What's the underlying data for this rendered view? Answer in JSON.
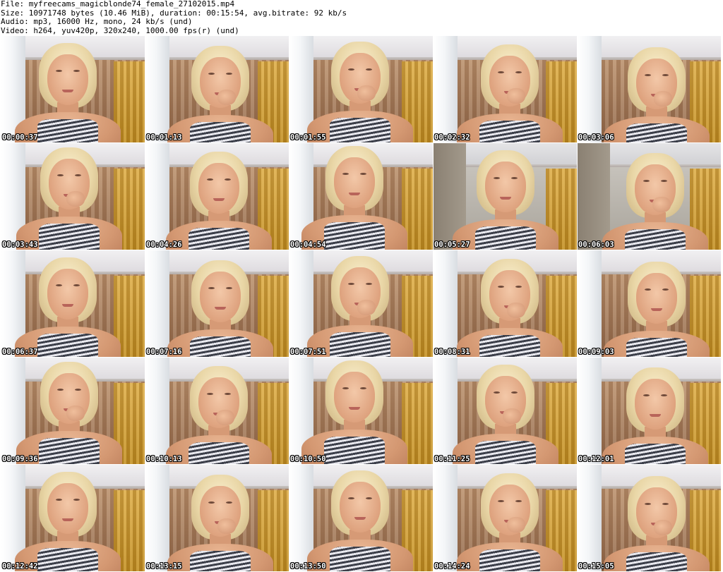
{
  "header": {
    "file_line": "File: myfreecams_magicblonde74_female_27102015.mp4",
    "size_line": "Size: 10971748 bytes (10.46 MiB), duration: 00:15:54, avg.bitrate: 92 kb/s",
    "audio_line": "Audio: mp3, 16000 Hz, mono, 24 kb/s (und)",
    "video_line": "Video: h264, yuv420p, 320x240, 1000.00 fps(r) (und)"
  },
  "thumbnails": [
    {
      "time": "00:00:37",
      "variant": "std",
      "hand": false
    },
    {
      "time": "00:01:13",
      "variant": "std",
      "hand": true
    },
    {
      "time": "00:01:55",
      "variant": "std",
      "hand": true
    },
    {
      "time": "00:02:32",
      "variant": "std",
      "hand": true
    },
    {
      "time": "00:03:06",
      "variant": "std",
      "hand": true
    },
    {
      "time": "00:03:43",
      "variant": "std",
      "hand": true
    },
    {
      "time": "00:04:26",
      "variant": "std",
      "hand": false
    },
    {
      "time": "00:04:54",
      "variant": "std",
      "hand": false
    },
    {
      "time": "00:05:27",
      "variant": "alt",
      "hand": false
    },
    {
      "time": "00:06:03",
      "variant": "alt",
      "hand": true
    },
    {
      "time": "00:06:37",
      "variant": "std",
      "hand": false
    },
    {
      "time": "00:07:16",
      "variant": "std",
      "hand": false
    },
    {
      "time": "00:07:51",
      "variant": "std",
      "hand": true
    },
    {
      "time": "00:08:31",
      "variant": "std",
      "hand": true
    },
    {
      "time": "00:09:03",
      "variant": "std",
      "hand": false
    },
    {
      "time": "00:09:36",
      "variant": "std",
      "hand": true
    },
    {
      "time": "00:10:13",
      "variant": "std",
      "hand": true
    },
    {
      "time": "00:10:50",
      "variant": "std",
      "hand": false
    },
    {
      "time": "00:11:25",
      "variant": "std",
      "hand": true
    },
    {
      "time": "00:12:01",
      "variant": "std",
      "hand": false
    },
    {
      "time": "00:12:42",
      "variant": "std",
      "hand": false
    },
    {
      "time": "00:13:15",
      "variant": "std",
      "hand": true
    },
    {
      "time": "00:13:50",
      "variant": "std",
      "hand": false
    },
    {
      "time": "00:14:24",
      "variant": "std",
      "hand": true
    },
    {
      "time": "00:15:05",
      "variant": "std",
      "hand": true
    }
  ]
}
